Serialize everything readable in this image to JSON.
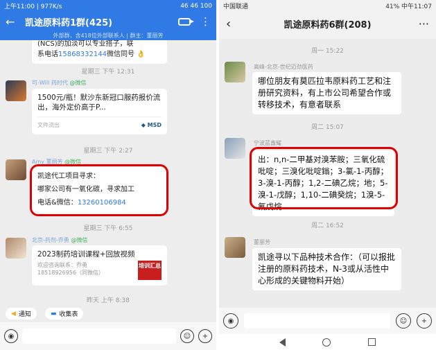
{
  "left": {
    "status": {
      "time": "上午11:00 | 977K/s",
      "right": "46 46 100"
    },
    "header": {
      "title": "凯途原料药1群(425)",
      "sub": "外部群，含418位外部联系人 | 群主：董丽芳"
    },
    "top_snippet": {
      "line1": "(NCS)的加淡可以专业搭子，联",
      "line2_prefix": "系电话",
      "phone": "15868332144",
      "line2_suffix": "微信同号"
    },
    "time1": "星期三  下午 12:31",
    "msg1": {
      "name": "可-Will",
      "company": "药时代",
      "wx": "@微信",
      "title": "1500元/瓶！默沙东新冠口服药报价流出，海外定价高于P...",
      "foot": "文件流出",
      "brand": "MSD"
    },
    "time2": "星期三  下午 2:27",
    "msg2": {
      "name": "Amy",
      "company": "董丽芳",
      "wx": "@微信",
      "line1": "凯途代工项目寻求：",
      "line2": "哪家公司有一氧化碳，寻求加工",
      "line3_prefix": "电话&微信：",
      "phone": "13260106984"
    },
    "time3": "星期三  下午 6:55",
    "msg3": {
      "name": "北京-药剂-乔勇",
      "wx": "@微信",
      "title": "2023制药培训课程+回放视频",
      "desc1": "欢迎咨询联系：乔勇",
      "desc2": "18518926956（同微信）",
      "badge": "培训汇总"
    },
    "time4": "昨天  上午 8:38",
    "toolbar": {
      "notice": "通知",
      "collect": "收集表"
    }
  },
  "right": {
    "status": {
      "carrier": "中国联通",
      "right": "41% 中午11:07"
    },
    "header": {
      "title": "凯途原料药6群(208)",
      "more": "···"
    },
    "time1": "周一 15:22",
    "msg1": {
      "name": "高峰-北京-世纪迈劲医药",
      "text": "哪位朋友有莫匹拉韦原料药工艺和注册研究资料，有上市公司希望合作或转移技术，有意者联系"
    },
    "time2": "周二 15:07",
    "msg2": {
      "name": "宁波蓝鑫耀",
      "text": "出：n,n-二甲基对溴苯胺；三氧化硫吡啶；三溴化吡啶鎓；3-氯-1-丙醇；3-溴-1-丙醇；1,2-二碘乙烷；地；5-溴-1-戊醇；1,10-二碘癸烷；1溴-5-氟戊烷"
    },
    "time3": "周二 16:52",
    "msg3": {
      "name": "董丽芳",
      "text": "凯途寻以下品种技术合作：（可以报批注册的原料药技术，N-3或从活性中心形成的关键物料开始）"
    }
  },
  "colors": {
    "accent": "#2f7ae5",
    "highlight": "#e00000",
    "link": "#2f7ae5"
  }
}
